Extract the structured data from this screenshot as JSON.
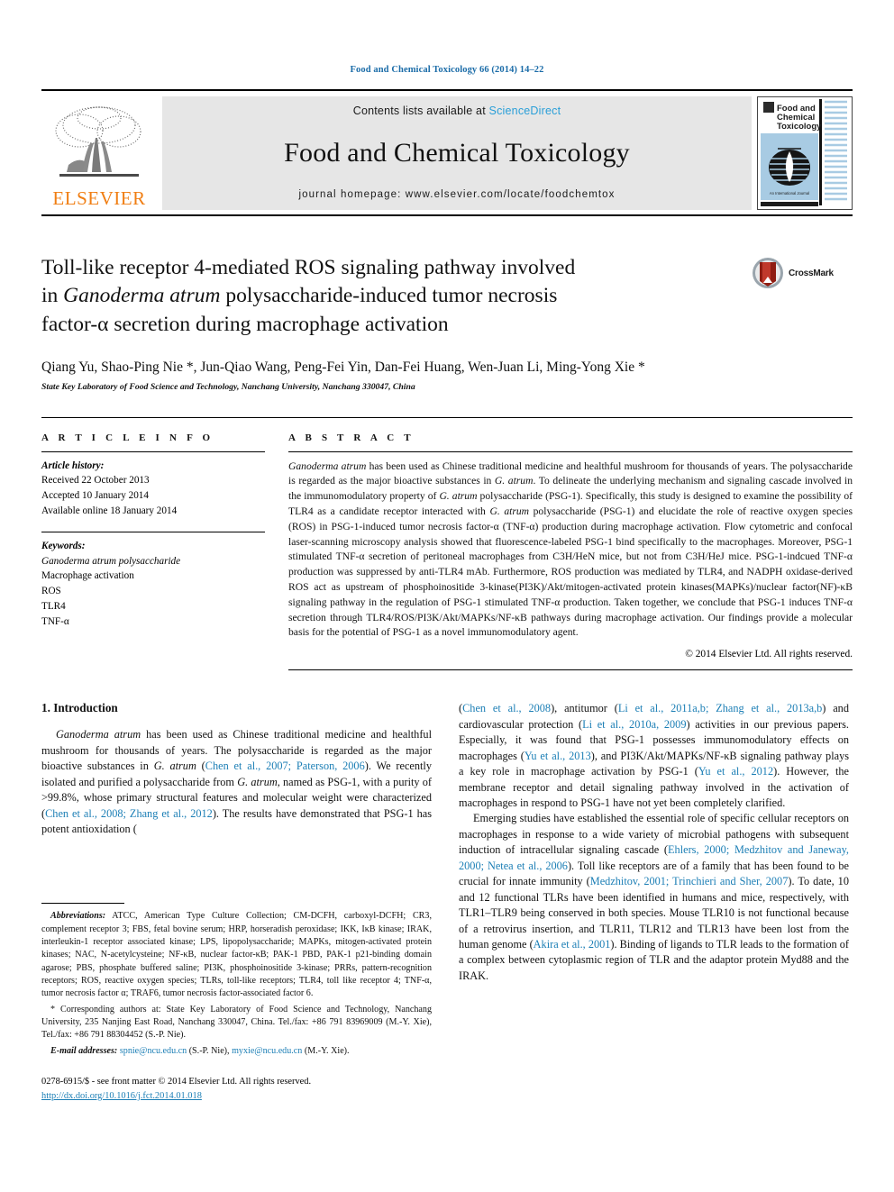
{
  "running_head": "Food and Chemical Toxicology 66 (2014) 14–22",
  "masthead": {
    "publisher_name": "ELSEVIER",
    "contents_prefix": "Contents lists available at ",
    "contents_link": "ScienceDirect",
    "journal_name": "Food and Chemical Toxicology",
    "homepage": "journal homepage: www.elsevier.com/locate/foodchemtox",
    "cover_title_line1": "Food and",
    "cover_title_line2": "Chemical",
    "cover_title_line3": "Toxicology",
    "cover_footer": "An International Journal",
    "link_color": "#2a9fd8"
  },
  "article": {
    "title_line1": "Toll-like receptor 4-mediated ROS signaling pathway involved",
    "title_line2_pre": "in ",
    "title_line2_italic": "Ganoderma atrum",
    "title_line2_post": " polysaccharide-induced tumor necrosis",
    "title_line3": "factor-α secretion during macrophage activation",
    "crossmark_label": "CrossMark",
    "authors": "Qiang Yu, Shao-Ping Nie *, Jun-Qiao Wang, Peng-Fei Yin, Dan-Fei Huang, Wen-Juan Li, Ming-Yong Xie *",
    "affiliation": "State Key Laboratory of Food Science and Technology, Nanchang University, Nanchang 330047, China"
  },
  "article_info": {
    "heading": "A R T I C L E   I N F O",
    "history_label": "Article history:",
    "history": [
      "Received 22 October 2013",
      "Accepted 10 January 2014",
      "Available online 18 January 2014"
    ],
    "keywords_label": "Keywords:",
    "keywords": [
      "Ganoderma atrum polysaccharide",
      "Macrophage activation",
      "ROS",
      "TLR4",
      "TNF-α"
    ]
  },
  "abstract": {
    "heading": "A B S T R A C T",
    "text_part1_italic": "Ganoderma atrum",
    "text_part1": " has been used as Chinese traditional medicine and healthful mushroom for thousands of years. The polysaccharide is regarded as the major bioactive substances in ",
    "text_gatrum_1": "G. atrum",
    "text_part2": ". To delineate the underlying mechanism and signaling cascade involved in the immunomodulatory property of ",
    "text_gatrum_2": "G. atrum",
    "text_part3": " polysaccharide (PSG-1). Specifically, this study is designed to examine the possibility of TLR4 as a candidate receptor interacted with ",
    "text_gatrum_3": "G. atrum",
    "text_part4": " polysaccharide (PSG-1) and elucidate the role of reactive oxygen species (ROS) in PSG-1-induced tumor necrosis factor-α (TNF-α) production during macrophage activation. Flow cytometric and confocal laser-scanning microscopy analysis showed that fluorescence-labeled PSG-1 bind specifically to the macrophages. Moreover, PSG-1 stimulated TNF-α secretion of peritoneal macrophages from C3H/HeN mice, but not from C3H/HeJ mice. PSG-1-indcued TNF-α production was suppressed by anti-TLR4 mAb. Furthermore, ROS production was mediated by TLR4, and NADPH oxidase-derived ROS act as upstream of phosphoinositide 3-kinase(PI3K)/Akt/mitogen-activated protein kinases(MAPKs)/nuclear factor(NF)-κB signaling pathway in the regulation of PSG-1 stimulated TNF-α production. Taken together, we conclude that PSG-1 induces TNF-α secretion through TLR4/ROS/PI3K/Akt/MAPKs/NF-κB pathways during macrophage activation. Our findings provide a molecular basis for the potential of PSG-1 as a novel immunomodulatory agent.",
    "copyright": "© 2014 Elsevier Ltd. All rights reserved."
  },
  "introduction": {
    "heading": "1. Introduction",
    "para1_a_italic": "Ganoderma atrum",
    "para1_a": " has been used as Chinese traditional medicine and healthful mushroom for thousands of years. The polysaccharide is regarded as the major bioactive substances in ",
    "para1_gatrum": "G. atrum",
    "para1_b_open": " (",
    "para1_cite1": "Chen et al., 2007; Paterson, 2006",
    "para1_c": "). We recently isolated and purified a polysaccharide from ",
    "para1_gatrum2": "G. atrum",
    "para1_d": ", named as PSG-1, with a purity of >99.8%, whose primary structural features and molecular weight were characterized (",
    "para1_cite2": "Chen et al., 2008; Zhang et al., 2012",
    "para1_e": "). The results have demonstrated that PSG-1 has potent antioxidation (",
    "para1_cite3": "Chen et al., 2008",
    "para1_f": "), antitumor (",
    "para1_cite4": "Li et al., 2011a,b; Zhang et al., 2013a,b",
    "para1_g": ") and cardiovascular protection (",
    "para1_cite5": "Li et al., 2010a, 2009",
    "para1_h": ") activities in our previous papers. Especially, it was found that PSG-1 possesses immunomodulatory effects on macrophages (",
    "para1_cite6": "Yu et al., 2013",
    "para1_i": "), and PI3K/Akt/MAPKs/NF-κB signaling pathway plays a key role in macrophage activation by PSG-1 (",
    "para1_cite7": "Yu et al., 2012",
    "para1_j": "). However, the membrane receptor and detail signaling pathway involved in the activation of macrophages in respond to PSG-1 have not yet been completely clarified.",
    "para2_a": "Emerging studies have established the essential role of specific cellular receptors on macrophages in response to a wide variety of microbial pathogens with subsequent induction of intracellular signaling cascade (",
    "para2_cite1": "Ehlers, 2000; Medzhitov and Janeway, 2000; Netea et al., 2006",
    "para2_b": "). Toll like receptors are of a family that has been found to be crucial for innate immunity (",
    "para2_cite2": "Medzhitov, 2001; Trinchieri and Sher, 2007",
    "para2_c": "). To date, 10 and 12 functional TLRs have been identified in humans and mice, respectively, with TLR1–TLR9 being conserved in both species. Mouse TLR10 is not functional because of a retrovirus insertion, and TLR11, TLR12 and TLR13 have been lost from the human genome (",
    "para2_cite3": "Akira et al., 2001",
    "para2_d": "). Binding of ligands to TLR leads to the formation of a complex between cytoplasmic region of TLR and the adaptor protein Myd88 and the IRAK."
  },
  "footnotes": {
    "abbrev_label": "Abbreviations:",
    "abbrev_text": " ATCC, American Type Culture Collection; CM-DCFH, carboxyl-DCFH; CR3, complement receptor 3; FBS, fetal bovine serum; HRP, horseradish peroxidase; IKK, IκB kinase; IRAK, interleukin-1 receptor associated kinase; LPS, lipopolysaccharide; MAPKs, mitogen-activated protein kinases; NAC, N-acetylcysteine; NF-κB, nuclear factor-κB; PAK-1 PBD, PAK-1 p21-binding domain agarose; PBS, phosphate buffered saline; PI3K, phosphoinositide 3-kinase; PRRs, pattern-recognition receptors; ROS, reactive oxygen species; TLRs, toll-like receptors; TLR4, toll like receptor 4; TNF-α, tumor necrosis factor α; TRAF6, tumor necrosis factor-associated factor 6.",
    "corresponding": "* Corresponding authors at: State Key Laboratory of Food Science and Technology, Nanchang University, 235 Nanjing East Road, Nanchang 330047, China. Tel./fax: +86 791 83969009 (M.-Y. Xie), Tel./fax: +86 791 88304452 (S.-P. Nie).",
    "email_label": "E-mail addresses:",
    "email1": "spnie@ncu.edu.cn",
    "email1_owner": " (S.-P. Nie), ",
    "email2": "myxie@ncu.edu.cn",
    "email2_owner": " (M.-Y. Xie).",
    "issn_line": "0278-6915/$ - see front matter © 2014 Elsevier Ltd. All rights reserved.",
    "doi_line": "http://dx.doi.org/10.1016/j.fct.2014.01.018"
  }
}
